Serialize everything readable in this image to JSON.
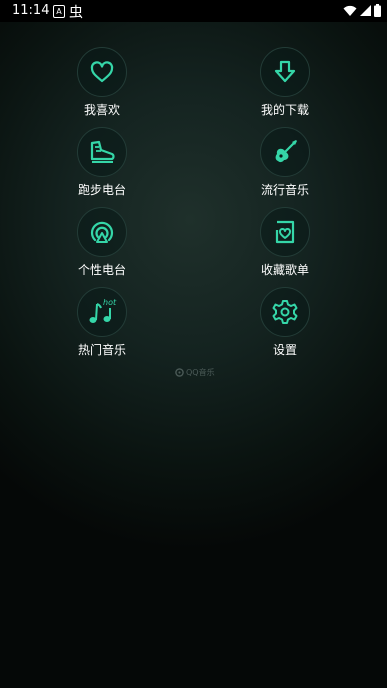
{
  "status_bar": {
    "time": "11:14",
    "notification_a": "A",
    "notification_bug": "虫",
    "icons": [
      "wifi-icon",
      "signal-icon",
      "battery-icon"
    ]
  },
  "menu": {
    "items": [
      {
        "label": "我喜欢",
        "icon": "heart-icon"
      },
      {
        "label": "我的下载",
        "icon": "download-icon"
      },
      {
        "label": "跑步电台",
        "icon": "running-shoe-icon"
      },
      {
        "label": "流行音乐",
        "icon": "guitar-icon"
      },
      {
        "label": "个性电台",
        "icon": "radio-icon"
      },
      {
        "label": "收藏歌单",
        "icon": "favorite-playlist-icon"
      },
      {
        "label": "热门音乐",
        "icon": "hot-music-icon"
      },
      {
        "label": "设置",
        "icon": "gear-icon"
      }
    ]
  },
  "brand": {
    "text": "QQ音乐"
  },
  "colors": {
    "accent": "#35d6a8",
    "background": "#0a1310",
    "circle_border": "#233c37"
  }
}
